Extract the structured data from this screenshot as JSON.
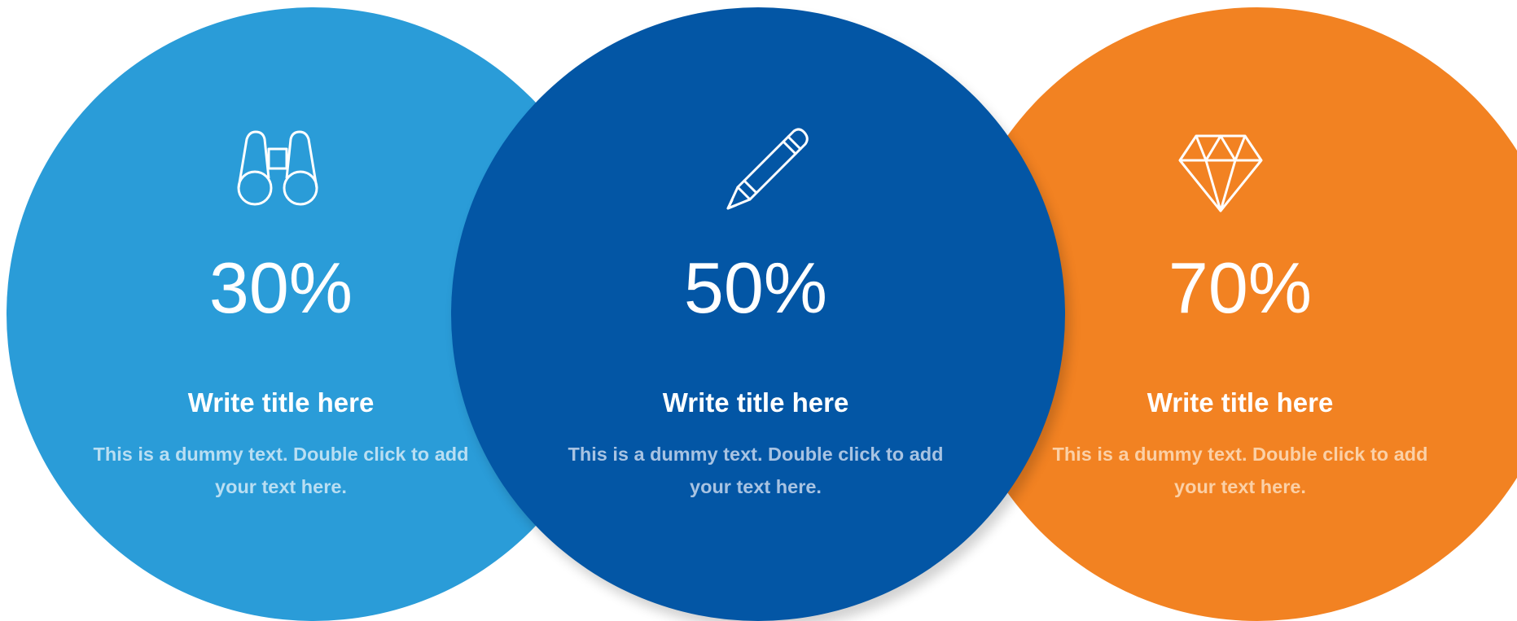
{
  "panels": [
    {
      "icon": "binoculars-icon",
      "percent": "30%",
      "title": "Write title here",
      "text": "This is a dummy text. Double click to add your text here."
    },
    {
      "icon": "pencil-icon",
      "percent": "50%",
      "title": "Write title here",
      "text": "This is a dummy text. Double click to add your text here."
    },
    {
      "icon": "diamond-icon",
      "percent": "70%",
      "title": "Write title here",
      "text": "This is a dummy text. Double click to add your text here."
    }
  ],
  "colors": {
    "left": "#2a9cd8",
    "center": "#0356a5",
    "right": "#f28222"
  }
}
